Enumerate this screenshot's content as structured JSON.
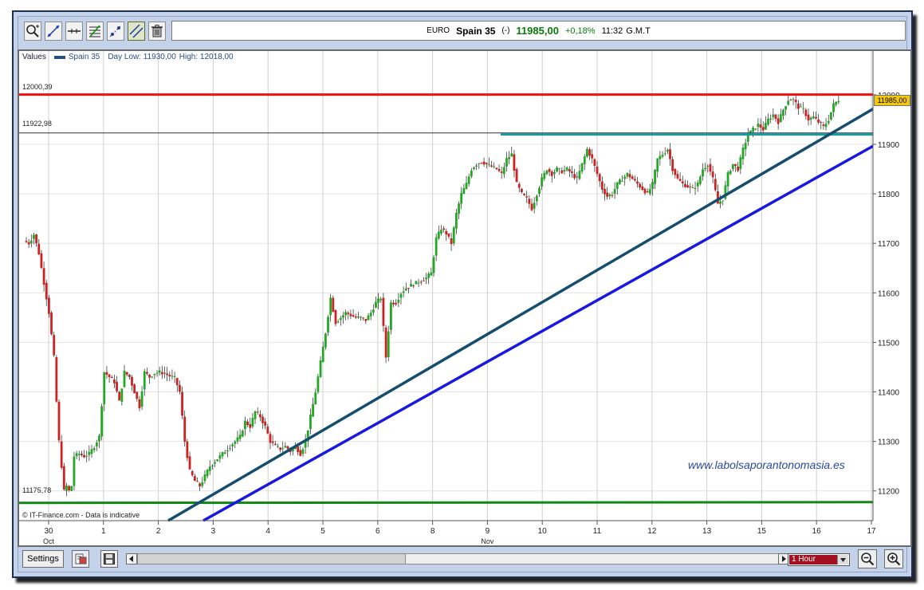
{
  "toolbar": {
    "tools": [
      "zoom-in-tool-icon",
      "trend-line-tool-icon",
      "horizontal-line-tool-icon",
      "fibonacci-tool-icon",
      "points-tool-icon",
      "parallel-line-tool-icon",
      "trash-icon"
    ]
  },
  "ticker": {
    "currency": "EURO",
    "symbol": "Spain 35",
    "flag": "(-)",
    "price": "11985,00",
    "change": "+0,18%",
    "time": "11:32",
    "tz": "G.M.T"
  },
  "header": {
    "values_label": "Values",
    "series_label": "Spain 35",
    "day_low": "Day Low: 11930,00",
    "day_high": "High: 12018,00"
  },
  "overlays": {
    "level_high_label": "12000,39",
    "level_mid_label": "11922,98",
    "level_low_label": "11175,78",
    "price_tag": "11985,00",
    "watermark": "www.labolsaporantonomasia.es",
    "copyright": "© IT-Finance.com - Data is indicative"
  },
  "bottom": {
    "settings_label": "Settings",
    "interval_label": "1 Hour"
  },
  "colors": {
    "resistance": "#ee1111",
    "support": "#118811",
    "teal": "#1a9aa0",
    "trend_dark": "#154d6e",
    "trend_blue": "#1818e0",
    "candle_up": "#22a822",
    "candle_down": "#cc2222"
  },
  "chart_data": {
    "type": "candlestick",
    "title": "",
    "series_name": "Spain 35",
    "y_ticks": [
      11200,
      11300,
      11400,
      11500,
      11600,
      11700,
      11800,
      11900,
      12000
    ],
    "y_tick_labels": [
      "11200",
      "11300",
      "11400",
      "11500",
      "11600",
      "11700",
      "11800",
      "11900",
      "12000"
    ],
    "ylim": [
      11140,
      12090
    ],
    "x_labels": [
      "30",
      "1",
      "2",
      "3",
      "4",
      "5",
      "6",
      "8",
      "9",
      "10",
      "11",
      "12",
      "13",
      "15",
      "16",
      "17"
    ],
    "x_sublabels": {
      "Oct": "30",
      "Nov": "9"
    },
    "horizontal_levels": [
      12000.39,
      11922.98,
      11175.78
    ],
    "key_levels_path": [
      [
        0,
        11705
      ],
      [
        2,
        11700
      ],
      [
        4,
        11718
      ],
      [
        6,
        11680
      ],
      [
        8,
        11620
      ],
      [
        10,
        11560
      ],
      [
        12,
        11470
      ],
      [
        13,
        11380
      ],
      [
        14,
        11300
      ],
      [
        15,
        11250
      ],
      [
        16,
        11200
      ],
      [
        17,
        11210
      ],
      [
        18,
        11200
      ],
      [
        19,
        11210
      ],
      [
        20,
        11270
      ],
      [
        22,
        11275
      ],
      [
        24,
        11270
      ],
      [
        26,
        11275
      ],
      [
        28,
        11290
      ],
      [
        30,
        11310
      ],
      [
        32,
        11440
      ],
      [
        34,
        11430
      ],
      [
        36,
        11420
      ],
      [
        38,
        11380
      ],
      [
        40,
        11440
      ],
      [
        42,
        11430
      ],
      [
        44,
        11400
      ],
      [
        46,
        11370
      ],
      [
        48,
        11440
      ],
      [
        50,
        11430
      ],
      [
        52,
        11438
      ],
      [
        54,
        11440
      ],
      [
        56,
        11437
      ],
      [
        58,
        11432
      ],
      [
        60,
        11428
      ],
      [
        62,
        11400
      ],
      [
        64,
        11300
      ],
      [
        66,
        11240
      ],
      [
        68,
        11220
      ],
      [
        70,
        11210
      ],
      [
        72,
        11230
      ],
      [
        74,
        11250
      ],
      [
        76,
        11260
      ],
      [
        78,
        11270
      ],
      [
        80,
        11280
      ],
      [
        82,
        11290
      ],
      [
        84,
        11300
      ],
      [
        86,
        11310
      ],
      [
        88,
        11340
      ],
      [
        90,
        11330
      ],
      [
        92,
        11360
      ],
      [
        94,
        11350
      ],
      [
        96,
        11330
      ],
      [
        98,
        11300
      ],
      [
        100,
        11290
      ],
      [
        102,
        11285
      ],
      [
        104,
        11290
      ],
      [
        106,
        11280
      ],
      [
        108,
        11290
      ],
      [
        110,
        11275
      ],
      [
        112,
        11300
      ],
      [
        114,
        11350
      ],
      [
        116,
        11400
      ],
      [
        118,
        11460
      ],
      [
        120,
        11520
      ],
      [
        122,
        11590
      ],
      [
        124,
        11540
      ],
      [
        126,
        11550
      ],
      [
        128,
        11560
      ],
      [
        130,
        11555
      ],
      [
        132,
        11550
      ],
      [
        134,
        11550
      ],
      [
        136,
        11545
      ],
      [
        138,
        11560
      ],
      [
        140,
        11580
      ],
      [
        142,
        11590
      ],
      [
        144,
        11470
      ],
      [
        146,
        11580
      ],
      [
        148,
        11580
      ],
      [
        150,
        11600
      ],
      [
        152,
        11610
      ],
      [
        154,
        11615
      ],
      [
        156,
        11620
      ],
      [
        158,
        11625
      ],
      [
        160,
        11630
      ],
      [
        162,
        11640
      ],
      [
        164,
        11710
      ],
      [
        166,
        11730
      ],
      [
        168,
        11720
      ],
      [
        170,
        11700
      ],
      [
        172,
        11760
      ],
      [
        174,
        11800
      ],
      [
        176,
        11820
      ],
      [
        178,
        11850
      ],
      [
        180,
        11860
      ],
      [
        182,
        11865
      ],
      [
        184,
        11860
      ],
      [
        186,
        11855
      ],
      [
        188,
        11850
      ],
      [
        190,
        11840
      ],
      [
        192,
        11870
      ],
      [
        194,
        11880
      ],
      [
        196,
        11820
      ],
      [
        198,
        11800
      ],
      [
        200,
        11790
      ],
      [
        202,
        11770
      ],
      [
        204,
        11800
      ],
      [
        206,
        11830
      ],
      [
        208,
        11850
      ],
      [
        210,
        11840
      ],
      [
        212,
        11850
      ],
      [
        214,
        11845
      ],
      [
        216,
        11850
      ],
      [
        218,
        11840
      ],
      [
        220,
        11830
      ],
      [
        222,
        11860
      ],
      [
        224,
        11890
      ],
      [
        226,
        11870
      ],
      [
        228,
        11840
      ],
      [
        230,
        11810
      ],
      [
        232,
        11795
      ],
      [
        234,
        11800
      ],
      [
        236,
        11820
      ],
      [
        238,
        11830
      ],
      [
        240,
        11840
      ],
      [
        242,
        11830
      ],
      [
        244,
        11820
      ],
      [
        246,
        11810
      ],
      [
        248,
        11800
      ],
      [
        250,
        11820
      ],
      [
        252,
        11870
      ],
      [
        254,
        11880
      ],
      [
        256,
        11890
      ],
      [
        258,
        11850
      ],
      [
        260,
        11830
      ],
      [
        262,
        11820
      ],
      [
        264,
        11815
      ],
      [
        266,
        11810
      ],
      [
        268,
        11820
      ],
      [
        270,
        11850
      ],
      [
        272,
        11860
      ],
      [
        274,
        11830
      ],
      [
        276,
        11780
      ],
      [
        278,
        11790
      ],
      [
        280,
        11840
      ],
      [
        282,
        11860
      ],
      [
        284,
        11850
      ],
      [
        286,
        11890
      ],
      [
        288,
        11920
      ],
      [
        290,
        11930
      ],
      [
        292,
        11940
      ],
      [
        294,
        11930
      ],
      [
        296,
        11950
      ],
      [
        298,
        11960
      ],
      [
        300,
        11945
      ],
      [
        302,
        11970
      ],
      [
        304,
        11990
      ],
      [
        306,
        11990
      ],
      [
        308,
        11975
      ],
      [
        310,
        11970
      ],
      [
        312,
        11950
      ],
      [
        314,
        11955
      ],
      [
        316,
        11945
      ],
      [
        318,
        11935
      ],
      [
        320,
        11950
      ],
      [
        322,
        11980
      ],
      [
        324,
        11990
      ]
    ]
  }
}
